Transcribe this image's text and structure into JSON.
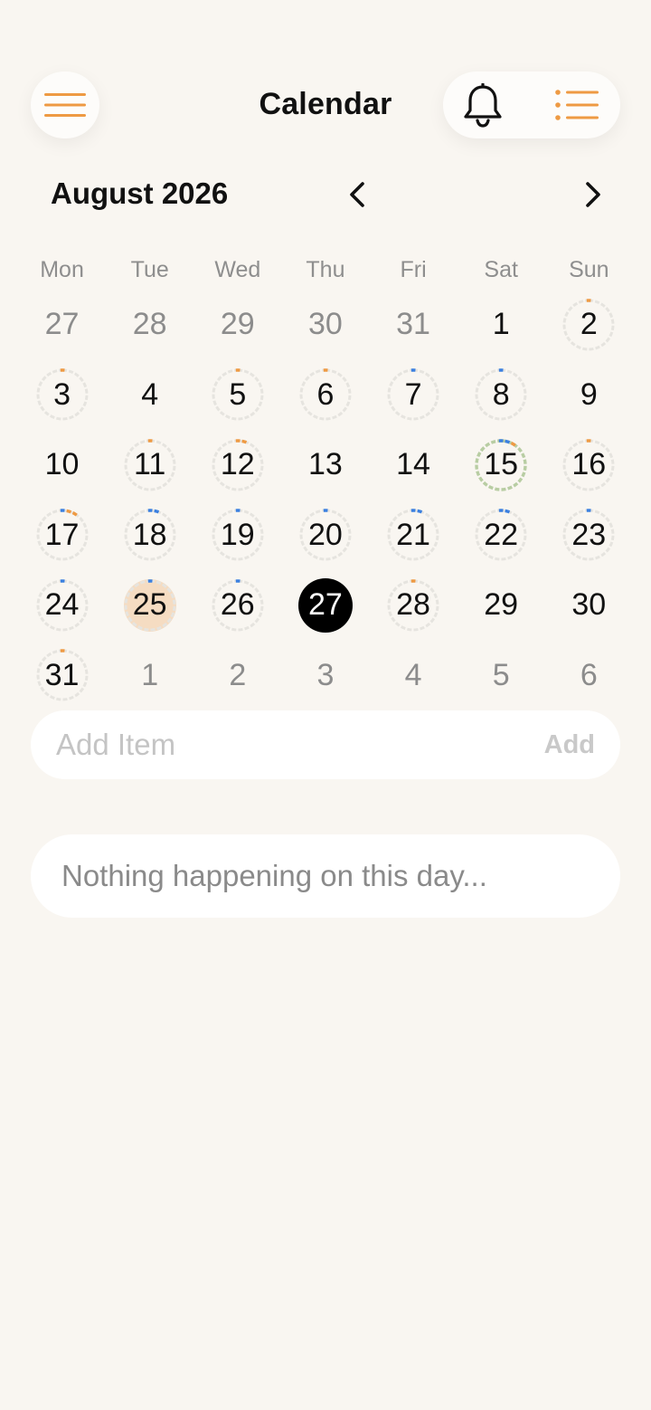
{
  "header": {
    "title": "Calendar",
    "accent_color": "#ee9a43",
    "icons": {
      "menu": "hamburger-menu-icon",
      "bell": "bell-icon",
      "list": "list-icon"
    }
  },
  "month_nav": {
    "label": "August 2026",
    "prev_icon": "chevron-left-icon",
    "next_icon": "chevron-right-icon"
  },
  "weekdays": [
    "Mon",
    "Tue",
    "Wed",
    "Thu",
    "Fri",
    "Sat",
    "Sun"
  ],
  "event_colors": {
    "orange": "#ee9a43",
    "blue": "#3b80e0",
    "green_ring": "#b8cda3",
    "track": "#e6e4df",
    "today_fill": "#f5dcc2",
    "selected_fill": "#000000"
  },
  "days": [
    {
      "n": "27",
      "other": true,
      "ring": false,
      "marks": []
    },
    {
      "n": "28",
      "other": true,
      "ring": false,
      "marks": []
    },
    {
      "n": "29",
      "other": true,
      "ring": false,
      "marks": []
    },
    {
      "n": "30",
      "other": true,
      "ring": false,
      "marks": []
    },
    {
      "n": "31",
      "other": true,
      "ring": false,
      "marks": []
    },
    {
      "n": "1",
      "other": false,
      "ring": false,
      "marks": []
    },
    {
      "n": "2",
      "other": false,
      "ring": true,
      "marks": [
        "orange"
      ]
    },
    {
      "n": "3",
      "other": false,
      "ring": true,
      "marks": [
        "orange"
      ]
    },
    {
      "n": "4",
      "other": false,
      "ring": false,
      "marks": []
    },
    {
      "n": "5",
      "other": false,
      "ring": true,
      "marks": [
        "orange"
      ]
    },
    {
      "n": "6",
      "other": false,
      "ring": true,
      "marks": [
        "orange"
      ]
    },
    {
      "n": "7",
      "other": false,
      "ring": true,
      "marks": [
        "blue"
      ]
    },
    {
      "n": "8",
      "other": false,
      "ring": true,
      "marks": [
        "blue"
      ]
    },
    {
      "n": "9",
      "other": false,
      "ring": false,
      "marks": []
    },
    {
      "n": "10",
      "other": false,
      "ring": false,
      "marks": []
    },
    {
      "n": "11",
      "other": false,
      "ring": true,
      "marks": [
        "orange"
      ]
    },
    {
      "n": "12",
      "other": false,
      "ring": true,
      "marks": [
        "orange",
        "orange"
      ]
    },
    {
      "n": "13",
      "other": false,
      "ring": false,
      "marks": []
    },
    {
      "n": "14",
      "other": false,
      "ring": false,
      "marks": []
    },
    {
      "n": "15",
      "other": false,
      "ring": true,
      "marks": [
        "blue",
        "blue",
        "orange"
      ],
      "state": "highlight"
    },
    {
      "n": "16",
      "other": false,
      "ring": true,
      "marks": [
        "orange"
      ]
    },
    {
      "n": "17",
      "other": false,
      "ring": true,
      "marks": [
        "blue",
        "orange",
        "orange"
      ]
    },
    {
      "n": "18",
      "other": false,
      "ring": true,
      "marks": [
        "blue",
        "blue"
      ]
    },
    {
      "n": "19",
      "other": false,
      "ring": true,
      "marks": [
        "blue"
      ]
    },
    {
      "n": "20",
      "other": false,
      "ring": true,
      "marks": [
        "blue"
      ]
    },
    {
      "n": "21",
      "other": false,
      "ring": true,
      "marks": [
        "blue",
        "blue"
      ]
    },
    {
      "n": "22",
      "other": false,
      "ring": true,
      "marks": [
        "blue",
        "blue"
      ]
    },
    {
      "n": "23",
      "other": false,
      "ring": true,
      "marks": [
        "blue"
      ]
    },
    {
      "n": "24",
      "other": false,
      "ring": true,
      "marks": [
        "blue"
      ]
    },
    {
      "n": "25",
      "other": false,
      "ring": true,
      "marks": [
        "blue"
      ],
      "state": "today"
    },
    {
      "n": "26",
      "other": false,
      "ring": true,
      "marks": [
        "blue"
      ]
    },
    {
      "n": "27",
      "other": false,
      "ring": false,
      "marks": [],
      "state": "selected"
    },
    {
      "n": "28",
      "other": false,
      "ring": true,
      "marks": [
        "orange"
      ]
    },
    {
      "n": "29",
      "other": false,
      "ring": false,
      "marks": []
    },
    {
      "n": "30",
      "other": false,
      "ring": false,
      "marks": []
    },
    {
      "n": "31",
      "other": false,
      "ring": true,
      "marks": [
        "orange"
      ]
    },
    {
      "n": "1",
      "other": true,
      "ring": false,
      "marks": []
    },
    {
      "n": "2",
      "other": true,
      "ring": false,
      "marks": []
    },
    {
      "n": "3",
      "other": true,
      "ring": false,
      "marks": []
    },
    {
      "n": "4",
      "other": true,
      "ring": false,
      "marks": []
    },
    {
      "n": "5",
      "other": true,
      "ring": false,
      "marks": []
    },
    {
      "n": "6",
      "other": true,
      "ring": false,
      "marks": []
    }
  ],
  "add_item": {
    "placeholder": "Add Item",
    "button_label": "Add"
  },
  "empty_state": {
    "text": "Nothing happening on this day..."
  }
}
